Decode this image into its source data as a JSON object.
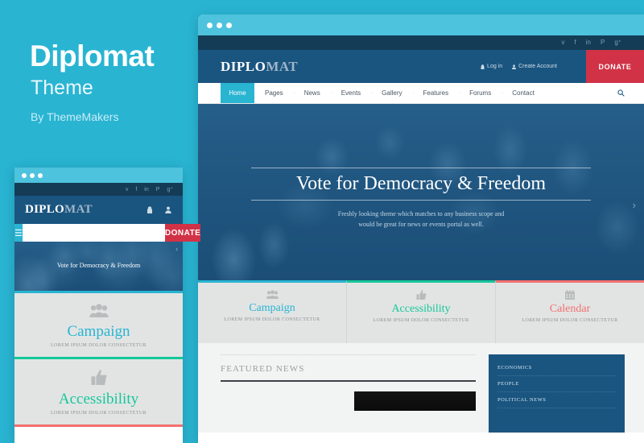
{
  "promo": {
    "title": "Diplomat",
    "subtitle": "Theme",
    "byline": "By ThemeMakers"
  },
  "window_controls": {
    "dots": 3
  },
  "site": {
    "topbar": {
      "social": [
        {
          "name": "twitter-icon",
          "glyph": "ᴠ"
        },
        {
          "name": "facebook-icon",
          "glyph": "f"
        },
        {
          "name": "linkedin-icon",
          "glyph": "in"
        },
        {
          "name": "pinterest-icon",
          "glyph": "P"
        },
        {
          "name": "googleplus-icon",
          "glyph": "g⁺"
        }
      ]
    },
    "header": {
      "logo_primary": "DIPLO",
      "logo_secondary": "MAT",
      "login_label": "Log in",
      "login_icon": "lock-icon",
      "create_account_label": "Create Account",
      "create_account_icon": "user-icon",
      "donate_label": "DONATE"
    },
    "nav": {
      "active": "Home",
      "items": [
        "Pages",
        "News",
        "Events",
        "Gallery",
        "Features",
        "Forums",
        "Contact"
      ],
      "search_icon": "search-icon"
    },
    "hero": {
      "title": "Vote for Democracy & Freedom",
      "subtitle_line1": "Freshly looking theme which matches to any business scope and",
      "subtitle_line2": "would be great for news or events portal as well.",
      "next_arrow": "chevron-right-icon"
    },
    "features": [
      {
        "icon": "users-icon",
        "glyph": "👥",
        "title": "Campaign",
        "subtitle": "LOREM IPSUM DOLOR CONSECTETUR",
        "color": "#29b4d2"
      },
      {
        "icon": "thumbs-up-icon",
        "glyph": "👍",
        "title": "Accessibility",
        "subtitle": "LOREM IPSUM DOLOR CONSECTETUR",
        "color": "#16c79a"
      },
      {
        "icon": "calendar-icon",
        "glyph": "📅",
        "title": "Calendar",
        "subtitle": "LOREM IPSUM DOLOR CONSECTETUR",
        "color": "#f2706f"
      }
    ],
    "featured_news": {
      "heading": "FEATURED NEWS",
      "thumbnails": [
        "news-thumb-building",
        "news-thumb-dark"
      ]
    },
    "categories": [
      "ECONOMICS",
      "PEOPLE",
      "POLITICAL NEWS"
    ]
  },
  "mobile": {
    "logo_primary": "DIPLO",
    "logo_secondary": "MAT",
    "lock_icon": "lock-icon",
    "user_icon": "user-icon",
    "menu_icon": "hamburger-menu-icon",
    "search_value": "",
    "search_placeholder": "",
    "donate_label": "DONATE",
    "hero_title": "Vote for Democracy & Freedom",
    "next_arrow": "chevron-right-icon"
  },
  "colors": {
    "brand_cyan": "#29b4d2",
    "header_blue": "#1a5580",
    "topbar_dark": "#143c56",
    "donate_red": "#d13246",
    "green": "#16c79a",
    "coral": "#f2706f"
  }
}
